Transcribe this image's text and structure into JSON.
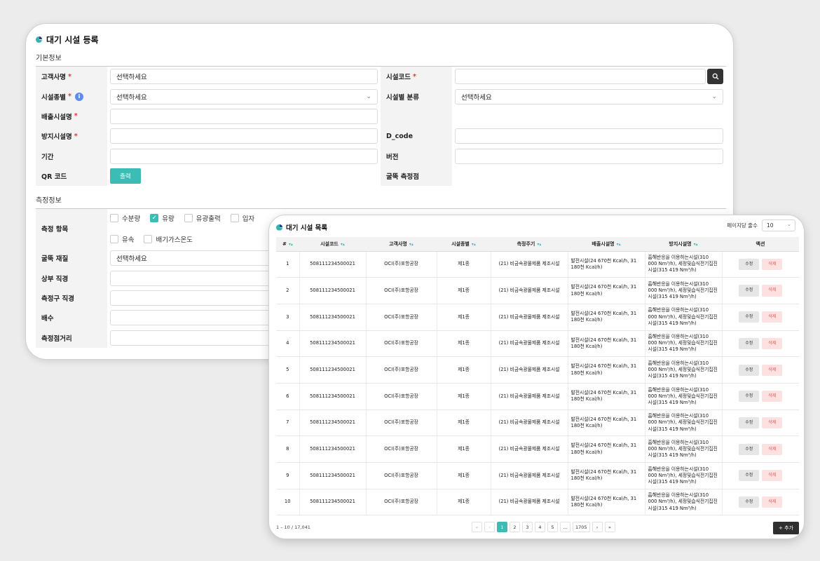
{
  "form": {
    "title": "대기 시설 등록",
    "section_basic": "기본정보",
    "section_measure": "측정정보",
    "rows": [
      {
        "left_label": "고객사명",
        "left_req": "*",
        "left_value": "선택하세요",
        "right_label": "시설코드",
        "right_req": "*",
        "right_value": ""
      },
      {
        "left_label": "시설종별",
        "left_req": "*",
        "left_value": "선택하세요",
        "right_label": "시설별 분류",
        "right_req": "",
        "right_value": "선택하세요"
      },
      {
        "left_label": "배출시설명",
        "left_req": "*",
        "left_value": "",
        "right_label": "",
        "right_req": "",
        "right_value": ""
      },
      {
        "left_label": "방지시설명",
        "left_req": "*",
        "left_value": "",
        "right_label": "D_code",
        "right_req": "",
        "right_value": ""
      },
      {
        "left_label": "기간",
        "left_req": "",
        "left_value": "",
        "right_label": "버전",
        "right_req": "",
        "right_value": ""
      },
      {
        "left_label": "QR 코드",
        "left_req": "",
        "left_value": "",
        "right_label": "굴뚝 측정점",
        "right_req": "",
        "right_value": ""
      }
    ],
    "qr_button": "출력",
    "measure_items_label": "측정 항목",
    "measure_items": [
      {
        "label": "수분량",
        "checked": false
      },
      {
        "label": "유량",
        "checked": true
      },
      {
        "label": "유광출력",
        "checked": false
      },
      {
        "label": "입자",
        "checked": false
      },
      {
        "label": "유속",
        "checked": false
      },
      {
        "label": "배기가스온도",
        "checked": false
      }
    ],
    "measure_rows": [
      {
        "label": "굴뚝 재질",
        "value": "선택하세요"
      },
      {
        "label": "상부 직경",
        "value": ""
      },
      {
        "label": "측정구 직경",
        "value": ""
      },
      {
        "label": "배수",
        "value": ""
      },
      {
        "label": "측정점거리",
        "value": ""
      }
    ]
  },
  "list": {
    "title": "대기 시설 목록",
    "per_page_label": "페이지당 줄수",
    "per_page_value": "10",
    "columns": [
      "#",
      "시설코드",
      "고객사명",
      "시설종별",
      "측정주기",
      "배출시설명",
      "방지시설명",
      "액션"
    ],
    "rows": [
      {
        "num": "1",
        "code": "508111234500021",
        "customer": "OCI(주)포항공장",
        "type": "제1종",
        "cycle": "(21) 비금속광물제품 제조시설",
        "emission": "발전시설(24 670천 Kcal/h, 31 180천 Kcal/h)",
        "prevention": "흡해반응을 이용하는시설(310 000 Nm³/h), 세정및습식전기집진시설(315 419 Nm³/h)"
      },
      {
        "num": "2",
        "code": "508111234500021",
        "customer": "OCI(주)포항공장",
        "type": "제1종",
        "cycle": "(21) 비금속광물제품 제조시설",
        "emission": "발전시설(24 670천 Kcal/h, 31 180천 Kcal/h)",
        "prevention": "흡해반응을 이용하는시설(310 000 Nm³/h), 세정및습식전기집진시설(315 419 Nm³/h)"
      },
      {
        "num": "3",
        "code": "508111234500021",
        "customer": "OCI(주)포항공장",
        "type": "제1종",
        "cycle": "(21) 비금속광물제품 제조시설",
        "emission": "발전시설(24 670천 Kcal/h, 31 180천 Kcal/h)",
        "prevention": "흡해반응을 이용하는시설(310 000 Nm³/h), 세정및습식전기집진시설(315 419 Nm³/h)"
      },
      {
        "num": "4",
        "code": "508111234500021",
        "customer": "OCI(주)포항공장",
        "type": "제1종",
        "cycle": "(21) 비금속광물제품 제조시설",
        "emission": "발전시설(24 670천 Kcal/h, 31 180천 Kcal/h)",
        "prevention": "흡해반응을 이용하는시설(310 000 Nm³/h), 세정및습식전기집진시설(315 419 Nm³/h)"
      },
      {
        "num": "5",
        "code": "508111234500021",
        "customer": "OCI(주)포항공장",
        "type": "제1종",
        "cycle": "(21) 비금속광물제품 제조시설",
        "emission": "발전시설(24 670천 Kcal/h, 31 180천 Kcal/h)",
        "prevention": "흡해반응을 이용하는시설(310 000 Nm³/h), 세정및습식전기집진시설(315 419 Nm³/h)"
      },
      {
        "num": "6",
        "code": "508111234500021",
        "customer": "OCI(주)포항공장",
        "type": "제1종",
        "cycle": "(21) 비금속광물제품 제조시설",
        "emission": "발전시설(24 670천 Kcal/h, 31 180천 Kcal/h)",
        "prevention": "흡해반응을 이용하는시설(310 000 Nm³/h), 세정및습식전기집진시설(315 419 Nm³/h)"
      },
      {
        "num": "7",
        "code": "508111234500021",
        "customer": "OCI(주)포항공장",
        "type": "제1종",
        "cycle": "(21) 비금속광물제품 제조시설",
        "emission": "발전시설(24 670천 Kcal/h, 31 180천 Kcal/h)",
        "prevention": "흡해반응을 이용하는시설(310 000 Nm³/h), 세정및습식전기집진시설(315 419 Nm³/h)"
      },
      {
        "num": "8",
        "code": "508111234500021",
        "customer": "OCI(주)포항공장",
        "type": "제1종",
        "cycle": "(21) 비금속광물제품 제조시설",
        "emission": "발전시설(24 670천 Kcal/h, 31 180천 Kcal/h)",
        "prevention": "흡해반응을 이용하는시설(310 000 Nm³/h), 세정및습식전기집진시설(315 419 Nm³/h)"
      },
      {
        "num": "9",
        "code": "508111234500021",
        "customer": "OCI(주)포항공장",
        "type": "제1종",
        "cycle": "(21) 비금속광물제품 제조시설",
        "emission": "발전시설(24 670천 Kcal/h, 31 180천 Kcal/h)",
        "prevention": "흡해반응을 이용하는시설(310 000 Nm³/h), 세정및습식전기집진시설(315 419 Nm³/h)"
      },
      {
        "num": "10",
        "code": "508111234500021",
        "customer": "OCI(주)포항공장",
        "type": "제1종",
        "cycle": "(21) 비금속광물제품 제조시설",
        "emission": "발전시설(24 670천 Kcal/h, 31 180천 Kcal/h)",
        "prevention": "흡해반응을 이용하는시설(310 000 Nm³/h), 세정및습식전기집진시설(315 419 Nm³/h)"
      }
    ],
    "edit_label": "수정",
    "delete_label": "삭제",
    "count_text": "1 – 10 / 17,041",
    "pager": {
      "first": "«",
      "prev": "‹",
      "pages": [
        "1",
        "2",
        "3",
        "4",
        "5",
        "...",
        "1705"
      ],
      "next": "›",
      "last": "»",
      "active": "1"
    },
    "add_button": "+ 추가"
  },
  "colors": {
    "accent": "#3bbdb5",
    "required": "#e53935",
    "info": "#5b8def",
    "dark": "#2f2f2f",
    "delete_bg": "#fde1e1"
  }
}
